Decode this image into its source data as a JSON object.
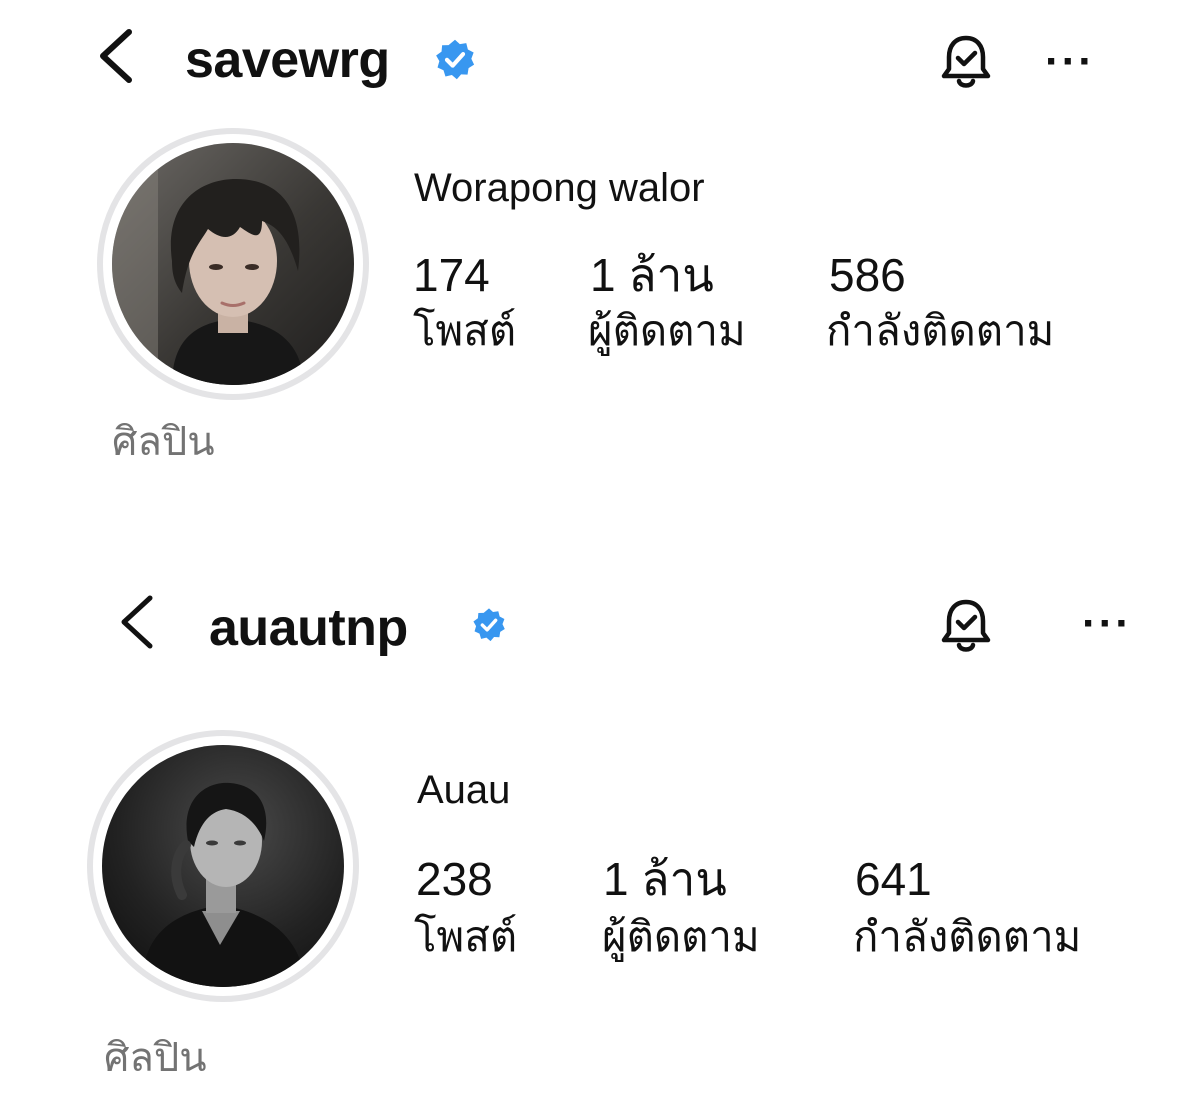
{
  "profiles": [
    {
      "username": "savewrg",
      "display_name": "Worapong walor",
      "stats": [
        {
          "value": "174",
          "label": "โพสต์"
        },
        {
          "value": "1 ล้าน",
          "label": "ผู้ติดตาม"
        },
        {
          "value": "586",
          "label": "กำลังติดตาม"
        }
      ],
      "category": "ศิลปิน"
    },
    {
      "username": "auautnp",
      "display_name": "Auau",
      "stats": [
        {
          "value": "238",
          "label": "โพสต์"
        },
        {
          "value": "1 ล้าน",
          "label": "ผู้ติดตาม"
        },
        {
          "value": "641",
          "label": "กำลังติดตาม"
        }
      ],
      "category": "ศิลปิน"
    }
  ],
  "more_label": "···",
  "icons": {
    "back": "chevron-left-icon",
    "verified": "verified-badge-icon",
    "notifications": "bell-check-icon"
  },
  "colors": {
    "verified_badge": "#3897f0",
    "secondary_text": "#737373",
    "avatar_ring": "#e4e4e6"
  }
}
